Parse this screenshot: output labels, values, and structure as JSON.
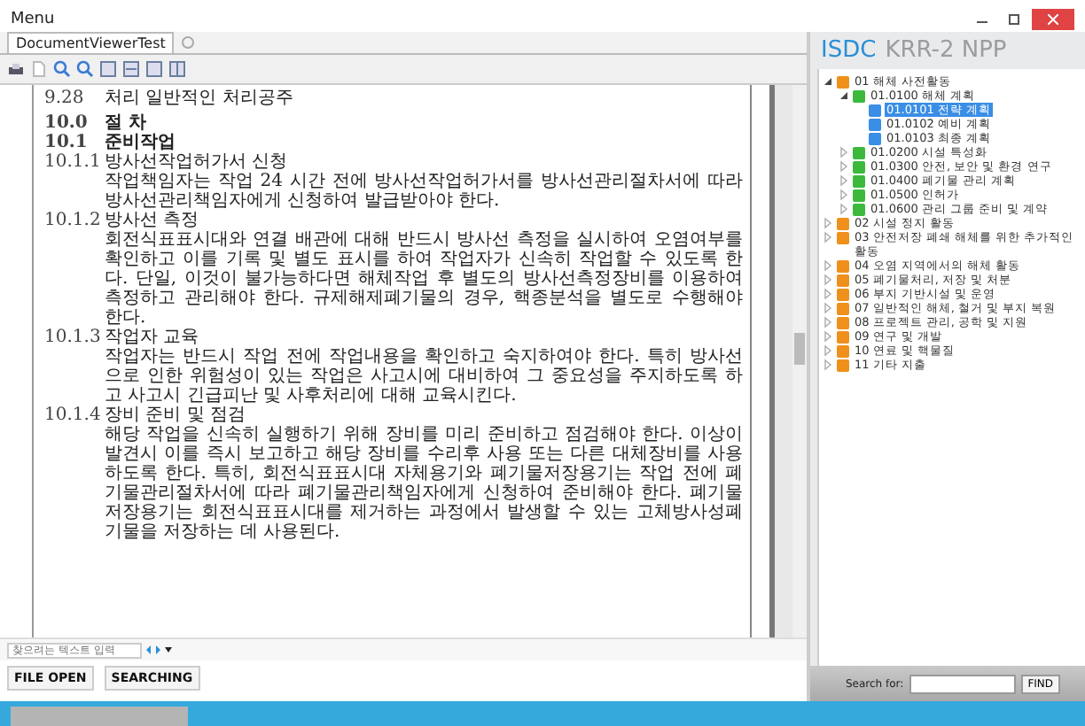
{
  "menu": {
    "label": "Menu"
  },
  "tabs": [
    {
      "label": "DocumentViewerTest",
      "selected": true
    }
  ],
  "document": {
    "lines": [
      {
        "kind": "row",
        "number": "9.28",
        "text": "처리 일반적인 처리공주"
      },
      {
        "kind": "heading",
        "number": "10.0",
        "text": "절 차"
      },
      {
        "kind": "subheading",
        "number": "10.1",
        "text": "준비작업"
      },
      {
        "kind": "item",
        "number": "10.1.1",
        "text": "방사선작업허가서 신청"
      },
      {
        "kind": "paragraph",
        "text": "작업책임자는 작업 24 시간 전에 방사선작업허가서를 방사선관리절차서에 따라 방사선관리책임자에게 신청하여 발급받아야 한다."
      },
      {
        "kind": "item",
        "number": "10.1.2",
        "text": "방사선 측정"
      },
      {
        "kind": "paragraph",
        "text": "회전식표표시대와 연결 배관에 대해 반드시 방사선 측정을 실시하여 오염여부를 확인하고 이를 기록 및 별도 표시를 하여 작업자가 신속히 작업할 수 있도록 한다. 단일, 이것이 불가능하다면 해체작업 후 별도의 방사선측정장비를 이용하여 측정하고 관리해야 한다. 규제해제폐기물의 경우, 핵종분석을 별도로 수행해야 한다."
      },
      {
        "kind": "item",
        "number": "10.1.3",
        "text": "작업자 교육"
      },
      {
        "kind": "paragraph",
        "text": "작업자는 반드시 작업 전에 작업내용을 확인하고 숙지하여야 한다. 특히 방사선으로 인한 위험성이 있는 작업은 사고시에 대비하여 그 중요성을 주지하도록 하고 사고시 긴급피난 및 사후처리에 대해 교육시킨다."
      },
      {
        "kind": "item",
        "number": "10.1.4",
        "text": "장비 준비 및 점검"
      },
      {
        "kind": "paragraph",
        "text": "해당 작업을 신속히 실행하기 위해 장비를 미리 준비하고 점검해야 한다. 이상이 발견시 이를 즉시 보고하고 해당 장비를 수리후 사용 또는 다른 대체장비를 사용하도록 한다. 특히, 회전식표표시대 자체용기와 폐기물저장용기는 작업 전에 폐기물관리절차서에 따라 폐기물관리책임자에게 신청하여 준비해야 한다. 폐기물저장용기는 회전식표표시대를 제거하는 과정에서 발생할 수 있는 고체방사성폐기물을 저장하는 데 사용된다."
      }
    ]
  },
  "search": {
    "placeholder": "찾으려는 텍스트 입력"
  },
  "buttons": [
    "FILE OPEN",
    "SEARCHING"
  ],
  "panel": {
    "title_primary": "ISDC",
    "title_secondary": "KRR-2 NPP",
    "tree": [
      {
        "label": "01 해체 사전활동",
        "expanded": true,
        "selected": false,
        "color": "#f0901c",
        "children": [
          {
            "label": "01.0100 해체 계획",
            "expanded": true,
            "selected": false,
            "color": "#3cb93c",
            "children": [
              {
                "label": "01.0101 전략 계획",
                "selected": true,
                "color": "#3a8ee6"
              },
              {
                "label": "01.0102 예비 계획",
                "selected": false,
                "color": "#3a8ee6"
              },
              {
                "label": "01.0103 최종 계획",
                "selected": false,
                "color": "#3a8ee6"
              }
            ]
          },
          {
            "label": "01.0200 시설 특성화",
            "expanded": false,
            "selected": false,
            "color": "#3cb93c"
          },
          {
            "label": "01.0300 안전, 보안 및 환경 연구",
            "expanded": false,
            "selected": false,
            "color": "#3cb93c"
          },
          {
            "label": "01.0400 폐기물 관리 계획",
            "expanded": false,
            "selected": false,
            "color": "#3cb93c"
          },
          {
            "label": "01.0500 인허가",
            "expanded": false,
            "selected": false,
            "color": "#3cb93c"
          },
          {
            "label": "01.0600 관리 그룹 준비 및 계약",
            "expanded": false,
            "selected": false,
            "color": "#3cb93c"
          }
        ]
      },
      {
        "label": "02 시설 정지 활동",
        "expanded": false,
        "selected": false,
        "color": "#f0901c"
      },
      {
        "label": "03 안전저장 폐쇄 해체를 위한 추가적인 활동",
        "expanded": false,
        "selected": false,
        "color": "#f0901c"
      },
      {
        "label": "04 오염 지역에서의 해체 활동",
        "expanded": false,
        "selected": false,
        "color": "#f0901c"
      },
      {
        "label": "05 폐기물처리, 저장 및 처분",
        "expanded": false,
        "selected": false,
        "color": "#f0901c"
      },
      {
        "label": "06 부지 기반시설 및 운영",
        "expanded": false,
        "selected": false,
        "color": "#f0901c"
      },
      {
        "label": "07 일반적인 해체, 철거 및 부지 복원",
        "expanded": false,
        "selected": false,
        "color": "#f0901c"
      },
      {
        "label": "08 프로젝트 관리, 공학 및 지원",
        "expanded": false,
        "selected": false,
        "color": "#f0901c"
      },
      {
        "label": "09 연구 및 개발",
        "expanded": false,
        "selected": false,
        "color": "#f0901c"
      },
      {
        "label": "10 연료 및 핵물질",
        "expanded": false,
        "selected": false,
        "color": "#f0901c"
      },
      {
        "label": "11 기타 지출",
        "expanded": false,
        "selected": false,
        "color": "#f0901c"
      }
    ],
    "search_label": "Search for:",
    "find_button": "FIND"
  }
}
